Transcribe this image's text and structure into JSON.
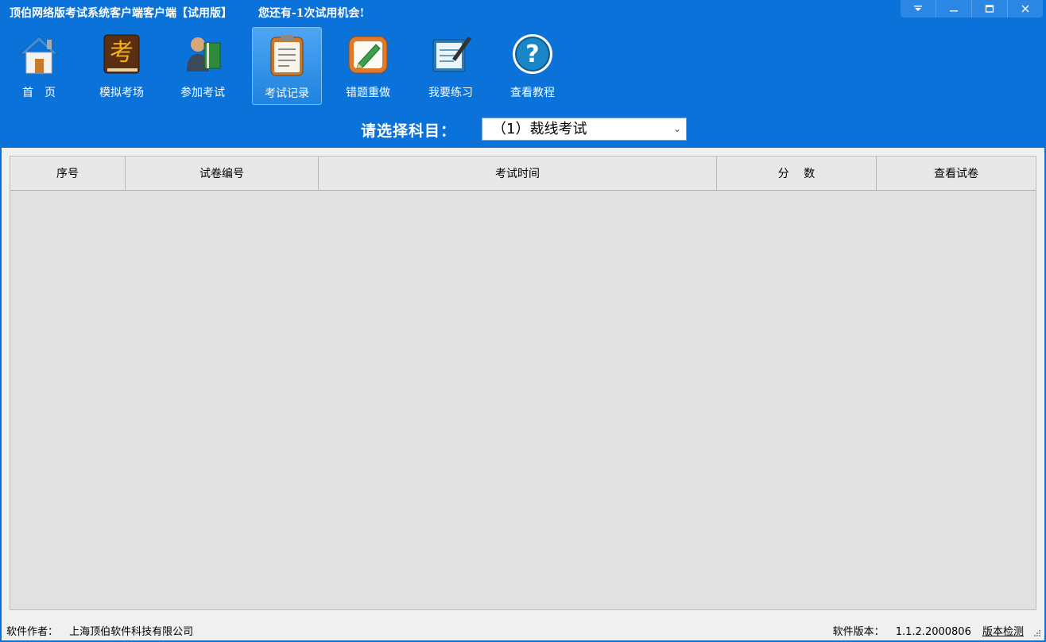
{
  "window": {
    "title": "顶伯网络版考试系统客户端客户端【试用版】",
    "trial_notice": "您还有-1次试用机会!",
    "controls": [
      "menu",
      "minimize",
      "maximize",
      "close"
    ]
  },
  "toolbar": {
    "items": [
      {
        "label": "首　页",
        "icon": "home-icon",
        "active": false
      },
      {
        "label": "模拟考场",
        "icon": "exam-book-icon",
        "active": false
      },
      {
        "label": "参加考试",
        "icon": "person-book-icon",
        "active": false
      },
      {
        "label": "考试记录",
        "icon": "clipboard-icon",
        "active": true
      },
      {
        "label": "错题重做",
        "icon": "pencil-note-icon",
        "active": false
      },
      {
        "label": "我要练习",
        "icon": "notebook-pen-icon",
        "active": false
      },
      {
        "label": "查看教程",
        "icon": "help-icon",
        "active": false
      }
    ]
  },
  "subject": {
    "label": "请选择科目：",
    "selected": "（1）裁线考试"
  },
  "table": {
    "columns": [
      "序号",
      "试卷编号",
      "考试时间",
      "分　 数",
      "查看试卷"
    ],
    "rows": []
  },
  "status": {
    "author_label": "软件作者：",
    "author": "上海顶伯软件科技有限公司",
    "version_label": "软件版本：",
    "version": "1.1.2.2000806",
    "check_link": "版本检测"
  },
  "colors": {
    "chrome": "#0a72d8",
    "active_tool": "#3b98ea",
    "grid_bg": "#e1e1e1"
  }
}
